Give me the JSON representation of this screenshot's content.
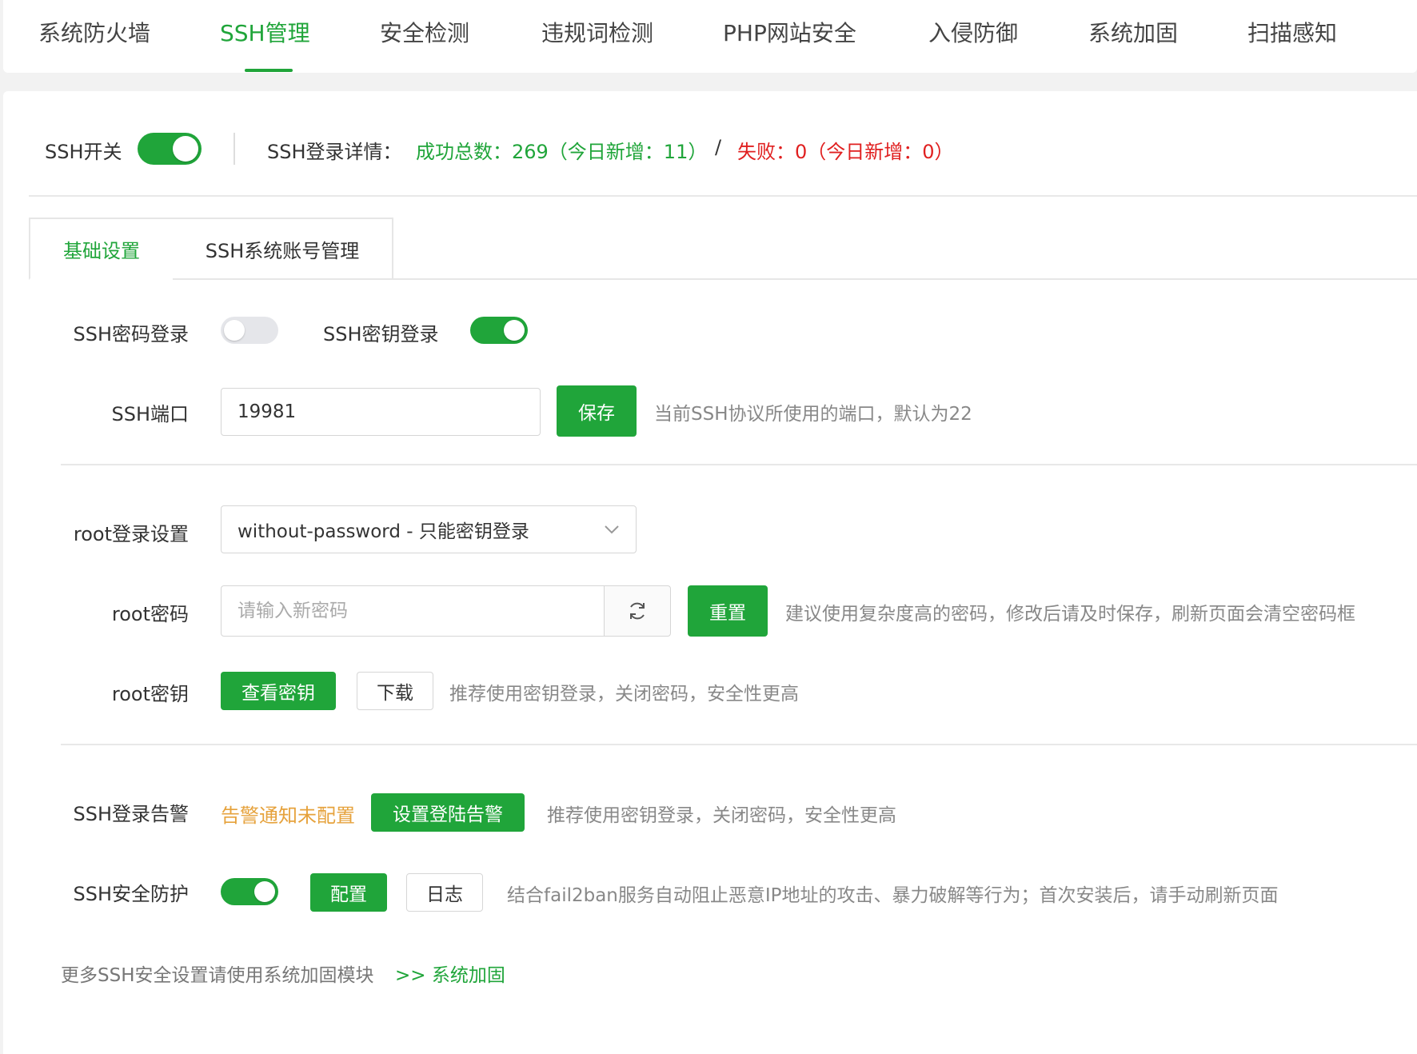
{
  "top_tabs": [
    {
      "label": "系统防火墙",
      "active": false
    },
    {
      "label": "SSH管理",
      "active": true
    },
    {
      "label": "安全检测",
      "active": false
    },
    {
      "label": "违规词检测",
      "active": false
    },
    {
      "label": "PHP网站安全",
      "active": false
    },
    {
      "label": "入侵防御",
      "active": false
    },
    {
      "label": "系统加固",
      "active": false
    },
    {
      "label": "扫描感知",
      "active": false
    }
  ],
  "header": {
    "ssh_switch_label": "SSH开关",
    "ssh_switch_on": true,
    "login_detail_label": "SSH登录详情：",
    "success_text": "成功总数：269（今日新增：11）",
    "separator": "/",
    "fail_text": "失败：0（今日新增：0）"
  },
  "sub_tabs": [
    {
      "label": "基础设置",
      "active": true
    },
    {
      "label": "SSH系统账号管理",
      "active": false
    }
  ],
  "basic": {
    "password_login_label": "SSH密码登录",
    "password_login_on": false,
    "key_login_label": "SSH密钥登录",
    "key_login_on": true,
    "port_label": "SSH端口",
    "port_value": "19981",
    "save_label": "保存",
    "port_hint": "当前SSH协议所使用的端口，默认为22"
  },
  "root": {
    "login_setting_label": "root登录设置",
    "login_setting_value": "without-password - 只能密钥登录",
    "password_label": "root密码",
    "password_placeholder": "请输入新密码",
    "reset_label": "重置",
    "password_hint": "建议使用复杂度高的密码，修改后请及时保存，刷新页面会清空密码框",
    "key_label": "root密钥",
    "view_key_label": "查看密钥",
    "download_label": "下载",
    "key_hint": "推荐使用密钥登录，关闭密码，安全性更高"
  },
  "alert": {
    "login_alert_label": "SSH登录告警",
    "alert_status": "告警通知未配置",
    "set_alert_label": "设置登陆告警",
    "alert_hint": "推荐使用密钥登录，关闭密码，安全性更高",
    "protection_label": "SSH安全防护",
    "protection_on": true,
    "config_label": "配置",
    "log_label": "日志",
    "protection_hint": "结合fail2ban服务自动阻止恶意IP地址的攻击、暴力破解等行为；首次安装后，请手动刷新页面"
  },
  "footer": {
    "more_text": "更多SSH安全设置请使用系统加固模块",
    "link_text": ">> 系统加固"
  },
  "colors": {
    "accent": "#20a53a",
    "danger": "#e02020",
    "warning": "#e6a23c"
  },
  "icons": {
    "refresh": "refresh-icon",
    "dropdown": "chevron-down-icon"
  }
}
